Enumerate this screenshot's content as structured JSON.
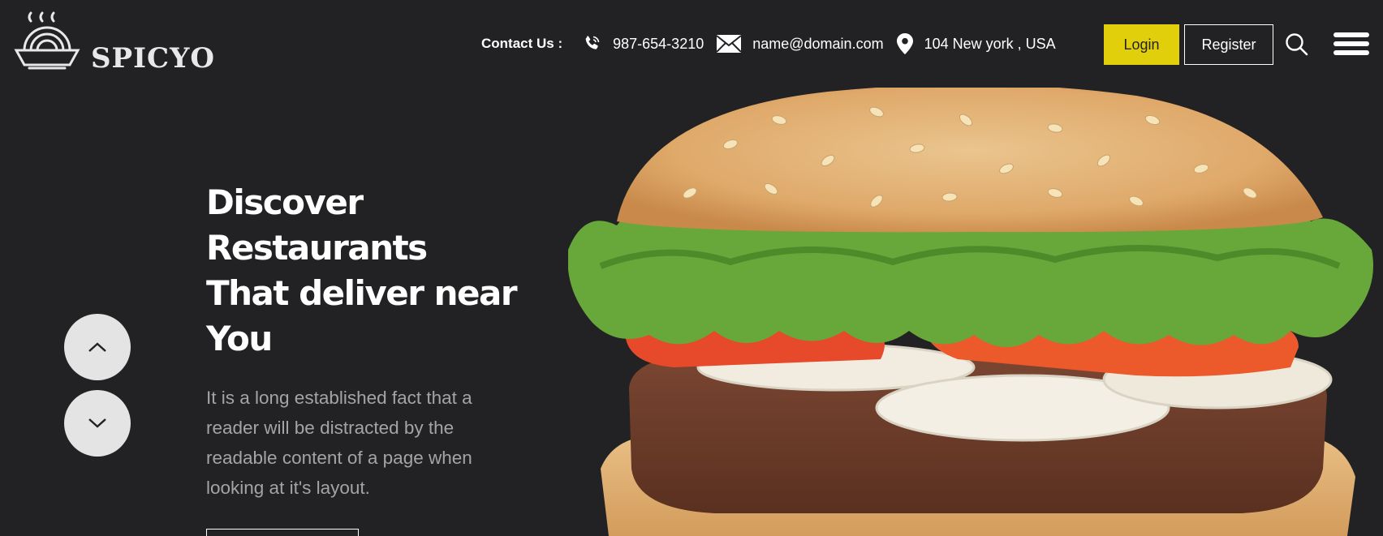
{
  "header": {
    "brand": "SPICYO",
    "contact_label": "Contact Us :",
    "phone": "987-654-3210",
    "email": "name@domain.com",
    "address": "104 New york , USA",
    "login_label": "Login",
    "register_label": "Register"
  },
  "hero": {
    "title_lines": [
      "Discover",
      "Restaurants",
      "That deliver near",
      "You"
    ],
    "description": "It is a long established fact that a reader will be distracted by the readable content of a page when looking at it's layout."
  },
  "colors": {
    "background": "#222124",
    "accent": "#e2cf0b",
    "muted_text": "#a4a4a6",
    "arrow_button": "#e4e4e4"
  },
  "icons": [
    "logo-bowl-icon",
    "phone-icon",
    "mail-icon",
    "location-pin-icon",
    "search-icon",
    "hamburger-menu-icon",
    "chevron-up-icon",
    "chevron-down-icon"
  ]
}
